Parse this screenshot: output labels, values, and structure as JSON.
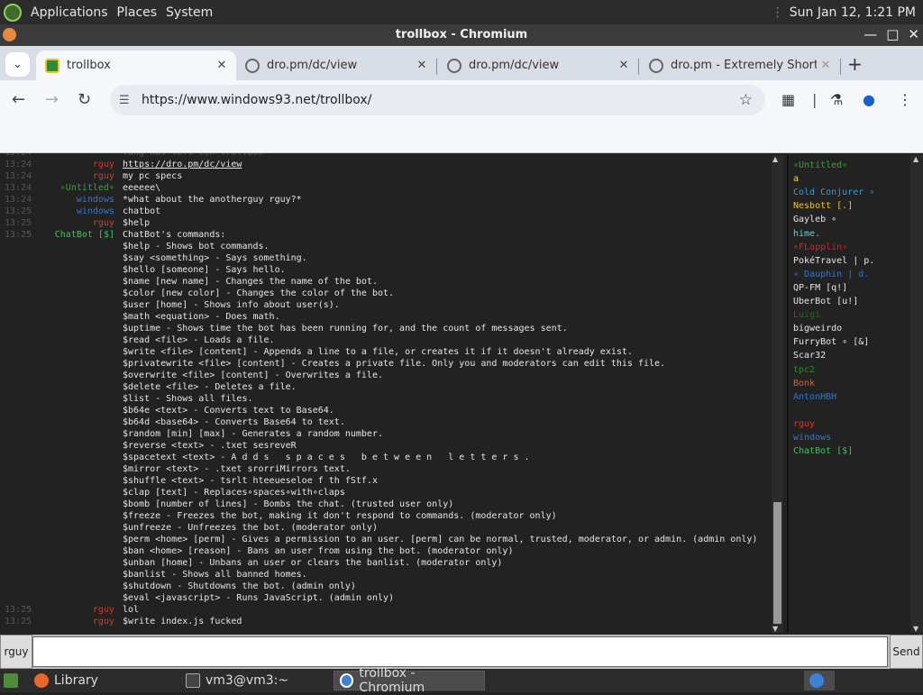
{
  "system_panel": {
    "menus": [
      "Applications",
      "Places",
      "System"
    ],
    "datetime": "Sun Jan 12,  1:21 PM"
  },
  "window": {
    "title": "trollbox - Chromium"
  },
  "tabs": [
    {
      "label": "trollbox",
      "active": true
    },
    {
      "label": "dro.pm/dc/view",
      "active": false
    },
    {
      "label": "dro.pm/dc/view",
      "active": false
    },
    {
      "label": "dro.pm - Extremely Short U",
      "active": false
    }
  ],
  "omnibox": {
    "url": "https://www.windows93.net/trollbox/"
  },
  "chat": {
    "lines": [
      {
        "ts": "13:24",
        "nick": "",
        "nick_color": "#555",
        "msg": "Yang has left teh trollbox",
        "dim": true
      },
      {
        "ts": "13:24",
        "nick": "rguy",
        "nick_color": "#d43b2c",
        "msg": "https://dro.pm/dc/view",
        "link": true
      },
      {
        "ts": "13:24",
        "nick": "rguy",
        "nick_color": "#d43b2c",
        "msg": "my pc specs"
      },
      {
        "ts": "13:24",
        "nick": "∘Untitled∘",
        "nick_color": "#3aa13a",
        "msg": "eeeeee\\"
      },
      {
        "ts": "13:24",
        "nick": "windows",
        "nick_color": "#2d78d6",
        "msg": "*what about the anotherguy rguy?*"
      },
      {
        "ts": "13:25",
        "nick": "windows",
        "nick_color": "#2d78d6",
        "msg": "chatbot"
      },
      {
        "ts": "13:25",
        "nick": "rguy",
        "nick_color": "#d43b2c",
        "msg": "$help"
      },
      {
        "ts": "13:25",
        "nick": "ChatBot [$]",
        "nick_color": "#2fc95a",
        "msg": "ChatBot's commands:"
      },
      {
        "ts": "",
        "nick": "",
        "nick_color": "#555",
        "msg": "$help - Shows bot commands."
      },
      {
        "ts": "",
        "nick": "",
        "nick_color": "#555",
        "msg": "$say <something> - Says something."
      },
      {
        "ts": "",
        "nick": "",
        "nick_color": "#555",
        "msg": "$hello [someone] - Says hello."
      },
      {
        "ts": "",
        "nick": "",
        "nick_color": "#555",
        "msg": "$name [new name] - Changes the name of the bot."
      },
      {
        "ts": "",
        "nick": "",
        "nick_color": "#555",
        "msg": "$color [new color] - Changes the color of the bot."
      },
      {
        "ts": "",
        "nick": "",
        "nick_color": "#555",
        "msg": "$user [home] - Shows info about user(s)."
      },
      {
        "ts": "",
        "nick": "",
        "nick_color": "#555",
        "msg": "$math <equation> - Does math."
      },
      {
        "ts": "",
        "nick": "",
        "nick_color": "#555",
        "msg": "$uptime - Shows time the bot has been running for, and the count of messages sent."
      },
      {
        "ts": "",
        "nick": "",
        "nick_color": "#555",
        "msg": "$read <file> - Loads a file."
      },
      {
        "ts": "",
        "nick": "",
        "nick_color": "#555",
        "msg": "$write <file> [content] - Appends a line to a file, or creates it if it doesn't already exist."
      },
      {
        "ts": "",
        "nick": "",
        "nick_color": "#555",
        "msg": "$privatewrite <file> [content] - Creates a private file. Only you and moderators can edit this file."
      },
      {
        "ts": "",
        "nick": "",
        "nick_color": "#555",
        "msg": "$overwrite <file> [content] - Overwrites a file."
      },
      {
        "ts": "",
        "nick": "",
        "nick_color": "#555",
        "msg": "$delete <file> - Deletes a file."
      },
      {
        "ts": "",
        "nick": "",
        "nick_color": "#555",
        "msg": "$list - Shows all files."
      },
      {
        "ts": "",
        "nick": "",
        "nick_color": "#555",
        "msg": "$b64e <text> - Converts text to Base64."
      },
      {
        "ts": "",
        "nick": "",
        "nick_color": "#555",
        "msg": "$b64d <base64> - Converts Base64 to text."
      },
      {
        "ts": "",
        "nick": "",
        "nick_color": "#555",
        "msg": "$random [min] [max] - Generates a random number."
      },
      {
        "ts": "",
        "nick": "",
        "nick_color": "#555",
        "msg": "$reverse <text> - .txet sesreveR"
      },
      {
        "ts": "",
        "nick": "",
        "nick_color": "#555",
        "msg": "$spacetext <text> - A d d s   s p a c e s   b e t w e e n   l e t t e r s ."
      },
      {
        "ts": "",
        "nick": "",
        "nick_color": "#555",
        "msg": "$mirror <text> - .txet srorriMirrors text."
      },
      {
        "ts": "",
        "nick": "",
        "nick_color": "#555",
        "msg": "$shuffle <text> - tsrlt hteeueseloe f th fStf.x"
      },
      {
        "ts": "",
        "nick": "",
        "nick_color": "#555",
        "msg": "$clap [text] - Replaces∘spaces∘with∘claps"
      },
      {
        "ts": "",
        "nick": "",
        "nick_color": "#555",
        "msg": "$bomb [number of lines] - Bombs the chat. (trusted user only)"
      },
      {
        "ts": "",
        "nick": "",
        "nick_color": "#555",
        "msg": "$freeze - Freezes the bot, making it don't respond to commands. (moderator only)"
      },
      {
        "ts": "",
        "nick": "",
        "nick_color": "#555",
        "msg": "$unfreeze - Unfreezes the bot. (moderator only)"
      },
      {
        "ts": "",
        "nick": "",
        "nick_color": "#555",
        "msg": "$perm <home> [perm] - Gives a permission to an user. [perm] can be normal, trusted, moderator, or admin. (admin only)"
      },
      {
        "ts": "",
        "nick": "",
        "nick_color": "#555",
        "msg": "$ban <home> [reason] - Bans an user from using the bot. (moderator only)"
      },
      {
        "ts": "",
        "nick": "",
        "nick_color": "#555",
        "msg": "$unban [home] - Unbans an user or clears the banlist. (moderator only)"
      },
      {
        "ts": "",
        "nick": "",
        "nick_color": "#555",
        "msg": "$banlist - Shows all banned homes."
      },
      {
        "ts": "",
        "nick": "",
        "nick_color": "#555",
        "msg": "$shutdown - Shutdowns the bot. (admin only)"
      },
      {
        "ts": "",
        "nick": "",
        "nick_color": "#555",
        "msg": "$eval <javascript> - Runs JavaScript. (admin only)"
      },
      {
        "ts": "13:25",
        "nick": "rguy",
        "nick_color": "#d43b2c",
        "msg": "lol"
      },
      {
        "ts": "13:25",
        "nick": "rguy",
        "nick_color": "#d43b2c",
        "msg": "$write index.js fucked"
      }
    ]
  },
  "users": [
    {
      "name": "∘Untitled∘",
      "color": "#3aa13a"
    },
    {
      "name": "a",
      "color": "#f0e030"
    },
    {
      "name": "Cold Conjurer ∘",
      "color": "#2d9fe0"
    },
    {
      "name": "Nesbott [.]",
      "color": "#f2c21b"
    },
    {
      "name": "Gayleb ∘",
      "color": "#e6e6e6"
    },
    {
      "name": "hime.",
      "color": "#4fd8e8"
    },
    {
      "name": "∘FLapplin∘",
      "color": "#c0292f"
    },
    {
      "name": "PokéTravel | p.",
      "color": "#e6e6e6"
    },
    {
      "name": "∘ Dauphin | d.",
      "color": "#2d78d6"
    },
    {
      "name": "QP-FM [q!]",
      "color": "#e6e6e6"
    },
    {
      "name": "UberBot [u!]",
      "color": "#e6e6e6"
    },
    {
      "name": "Luigi",
      "color": "#1e6b1e"
    },
    {
      "name": "bigweirdo",
      "color": "#e6e6e6"
    },
    {
      "name": "FurryBot ∘ [&]",
      "color": "#e6e6e6"
    },
    {
      "name": "Scar32",
      "color": "#e6e6e6"
    },
    {
      "name": "tpc2",
      "color": "#2e8b2e"
    },
    {
      "name": "Bonk",
      "color": "#e85a1e"
    },
    {
      "name": "AntonHBH",
      "color": "#2d78d6"
    },
    {
      "name": "",
      "color": "#222"
    },
    {
      "name": "rguy",
      "color": "#d43b2c"
    },
    {
      "name": "windows",
      "color": "#2d78d6"
    },
    {
      "name": "ChatBot [$]",
      "color": "#2fc95a"
    }
  ],
  "input": {
    "nick": "rguy",
    "value": "",
    "send_label": "Send"
  },
  "taskbar": {
    "items": [
      {
        "label": "Library",
        "active": false
      },
      {
        "label": "vm3@vm3:~",
        "active": false
      },
      {
        "label": "trollbox - Chromium",
        "active": true
      }
    ]
  }
}
